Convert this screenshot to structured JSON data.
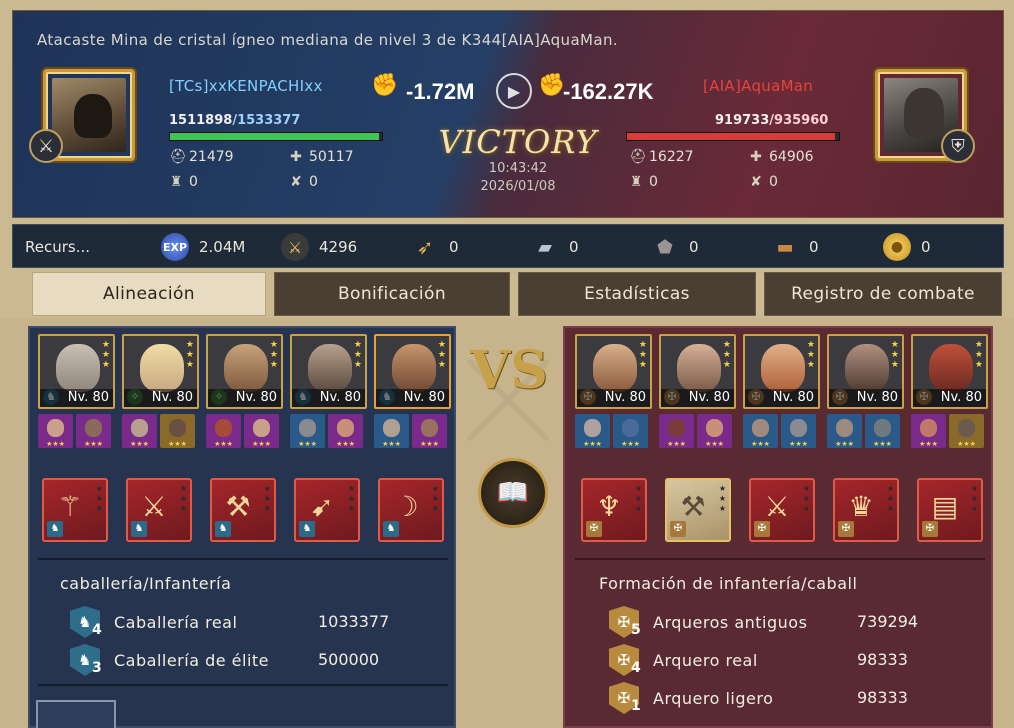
{
  "banner": {
    "message": "Atacaste Mina de cristal ígneo mediana de nivel 3 de K344[AIA]AquaMan.",
    "result": "VICTORY",
    "time": "10:43:42",
    "date": "2026/01/08",
    "attacker": {
      "name": "[TCs]xxKENPACHIxx",
      "hp_current": "1511898",
      "hp_max": "/1533377",
      "hp_fraction": 0.986,
      "loss": "-1.72M",
      "stat_troops": "21479",
      "stat_heal": "50117",
      "stat_tower": "0",
      "stat_trap": "0",
      "badge_icon": "sword-icon"
    },
    "defender": {
      "name": "[AIA]AquaMan",
      "hp_current": "919733",
      "hp_max": "/935960",
      "hp_fraction": 0.983,
      "loss": "-162.27K",
      "stat_troops": "16227",
      "stat_heal": "64906",
      "stat_tower": "0",
      "stat_trap": "0",
      "badge_icon": "shield-icon"
    }
  },
  "resources": {
    "label": "Recurs...",
    "items": [
      {
        "icon": "exp-icon",
        "value": "2.04M"
      },
      {
        "icon": "kill-score-icon",
        "value": "4296"
      },
      {
        "icon": "wheat-icon",
        "value": "0"
      },
      {
        "icon": "iron-icon",
        "value": "0"
      },
      {
        "icon": "stone-icon",
        "value": "0"
      },
      {
        "icon": "wood-icon",
        "value": "0"
      },
      {
        "icon": "gold-icon",
        "value": "0"
      }
    ]
  },
  "tabs": [
    {
      "label": "Alineación",
      "active": true
    },
    {
      "label": "Bonificación",
      "active": false
    },
    {
      "label": "Estadísticas",
      "active": false
    },
    {
      "label": "Registro de combate",
      "active": false
    }
  ],
  "left_side": {
    "hero_level": "Nv. 80",
    "formation_title": "caballería/Infantería",
    "troops": [
      {
        "name": "Caballería real",
        "count": "1033377",
        "tier": "4",
        "icon": "cavalry-icon"
      },
      {
        "name": "Caballería de élite",
        "count": "500000",
        "tier": "3",
        "icon": "cavalry-icon"
      }
    ]
  },
  "right_side": {
    "hero_level": "Nv. 80",
    "formation_title": "Formación de infantería/caball",
    "troops": [
      {
        "name": "Arqueros antiguos",
        "count": "739294",
        "tier": "5",
        "icon": "archer-icon"
      },
      {
        "name": "Arquero real",
        "count": "98333",
        "tier": "4",
        "icon": "archer-icon"
      },
      {
        "name": "Arquero ligero",
        "count": "98333",
        "tier": "1",
        "icon": "archer-icon"
      }
    ]
  },
  "vs_label": "VS",
  "colors": {
    "attacker_name": "#7fd0ff",
    "defender_name": "#e8423a",
    "attacker_hp": "#3fc45a",
    "defender_hp": "#d93a3a"
  }
}
